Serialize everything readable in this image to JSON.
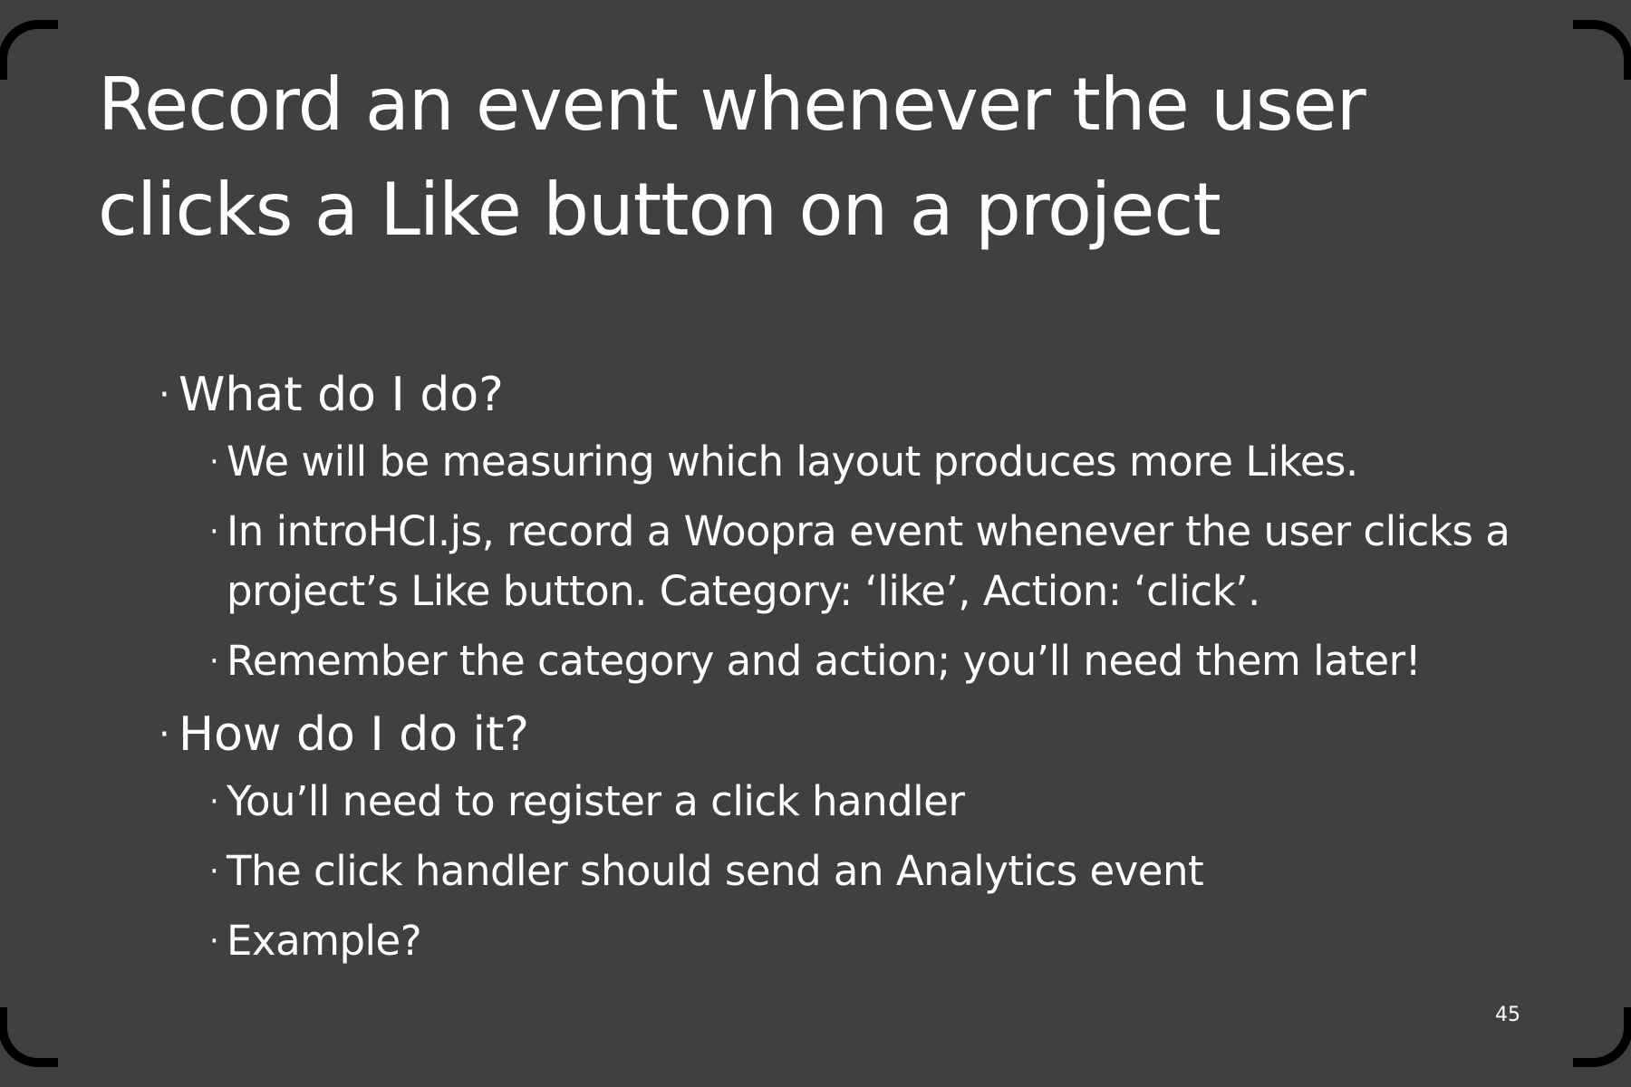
{
  "slide": {
    "title": "Record an event whenever the user clicks a Like button on a project",
    "bullet_glyph": "·",
    "sections": [
      {
        "heading": "What do I do?",
        "items": [
          "We will be measuring which layout produces more Likes.",
          "In introHCI.js, record a Woopra event whenever the user clicks a project’s Like button. Category: ‘like’, Action: ‘click’.",
          "Remember the category and action; you’ll need them later!"
        ]
      },
      {
        "heading": "How do I do it?",
        "items": [
          "You’ll need to register a click handler",
          "The click handler should send an Analytics event",
          "Example?"
        ]
      }
    ],
    "page_number": "45"
  }
}
